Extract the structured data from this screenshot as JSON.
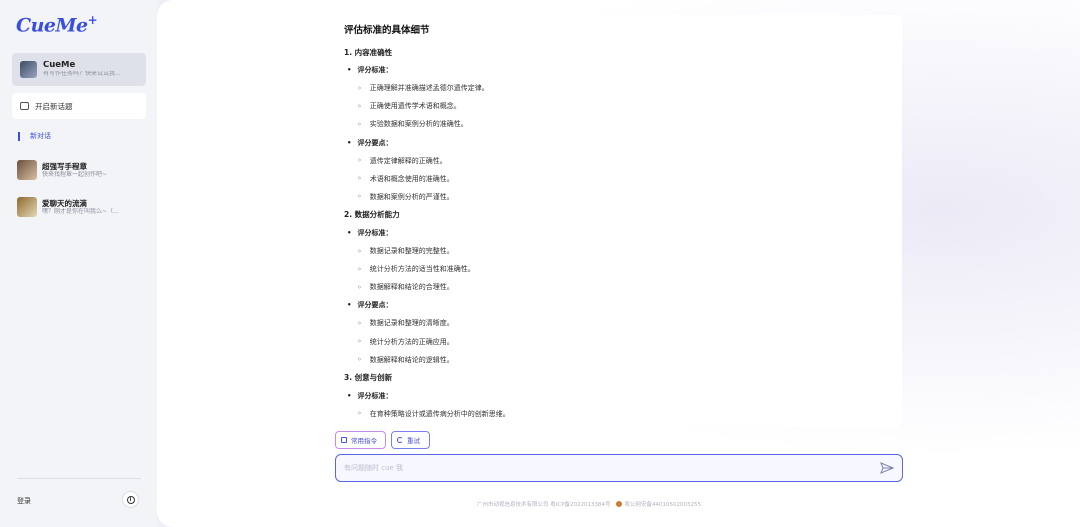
{
  "app": {
    "logo": "CueMe",
    "logo_plus": "+"
  },
  "sidebar": {
    "agent": {
      "name": "CueMe",
      "subtitle": "有写作任务吗？快来试试我..."
    },
    "new_chat_label": "开启新话题",
    "new_dialog_label": "新对话",
    "conversations": [
      {
        "title": "超强写手程章",
        "subtitle": "快来找程章一起创作吧~"
      },
      {
        "title": "爱聊天的流滴",
        "subtitle": "嘿？刚才是你在叫我么~（..."
      }
    ],
    "login_label": "登录",
    "info_label": "i"
  },
  "document": {
    "title": "评估标准的具体细节",
    "lines": [
      {
        "kind": "h2",
        "text": "1. 内容准确性"
      },
      {
        "kind": "b1",
        "text": "评分标准："
      },
      {
        "kind": "b2",
        "text": "正确理解并准确描述孟德尔遗传定律。"
      },
      {
        "kind": "b2",
        "text": "正确使用遗传学术语和概念。"
      },
      {
        "kind": "b2",
        "text": "实验数据和案例分析的准确性。"
      },
      {
        "kind": "b1",
        "text": "评分要点："
      },
      {
        "kind": "b2",
        "text": "遗传定律解释的正确性。"
      },
      {
        "kind": "b2",
        "text": "术语和概念使用的准确性。"
      },
      {
        "kind": "b2",
        "text": "数据和案例分析的严谨性。"
      },
      {
        "kind": "h2",
        "text": "2. 数据分析能力"
      },
      {
        "kind": "b1",
        "text": "评分标准："
      },
      {
        "kind": "b2",
        "text": "数据记录和整理的完整性。"
      },
      {
        "kind": "b2",
        "text": "统计分析方法的适当性和准确性。"
      },
      {
        "kind": "b2",
        "text": "数据解释和结论的合理性。"
      },
      {
        "kind": "b1",
        "text": "评分要点："
      },
      {
        "kind": "b2",
        "text": "数据记录和整理的清晰度。"
      },
      {
        "kind": "b2",
        "text": "统计分析方法的正确应用。"
      },
      {
        "kind": "b2",
        "text": "数据解释和结论的逻辑性。"
      },
      {
        "kind": "h2",
        "text": "3. 创意与创新"
      },
      {
        "kind": "b1",
        "text": "评分标准："
      },
      {
        "kind": "b2",
        "text": "在育种策略设计或遗传病分析中的创新思维。"
      }
    ]
  },
  "actions": {
    "common_commands": "常用指令",
    "retry": "重试"
  },
  "input": {
    "placeholder": "有问题随时 cue 我",
    "value": ""
  },
  "footer": {
    "icp": "广州市动视信息技术有限公司 粤ICP备2022013384号",
    "police": "粤公网安备44010502003255"
  },
  "colors": {
    "accent": "#3a4ee0",
    "input_border": "#5b66e8"
  }
}
